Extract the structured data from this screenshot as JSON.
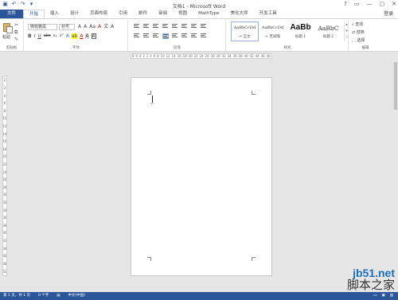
{
  "window": {
    "title": "文档1 - Microsoft Word",
    "controls": [
      "?",
      "▭",
      "—",
      "▢",
      "✕"
    ]
  },
  "quick_access": {
    "icons": [
      "save-icon",
      "undo-icon",
      "redo-icon",
      "customize-icon"
    ]
  },
  "tabs": [
    {
      "label": "文件",
      "kind": "file"
    },
    {
      "label": "开始",
      "kind": "active"
    },
    {
      "label": "插入"
    },
    {
      "label": "设计"
    },
    {
      "label": "页面布局"
    },
    {
      "label": "引用"
    },
    {
      "label": "邮件"
    },
    {
      "label": "审阅"
    },
    {
      "label": "视图"
    },
    {
      "label": "MathType"
    },
    {
      "label": "美化大师"
    },
    {
      "label": "开发工具"
    }
  ],
  "user_label": "登录",
  "ribbon": {
    "clipboard": {
      "group_label": "剪贴板",
      "paste_label": "粘贴"
    },
    "font": {
      "group_label": "字体",
      "font_name": "微软雅黑",
      "font_size": "初号",
      "row1": [
        "A",
        "A",
        "Aa",
        "A",
        "文",
        "A"
      ],
      "row2": [
        "B",
        "I",
        "U",
        "abc",
        "x₂",
        "x²",
        "A",
        "ab",
        "A",
        "A",
        "A"
      ]
    },
    "paragraph": {
      "group_label": "段落"
    },
    "styles": {
      "group_label": "样式",
      "items": [
        {
          "preview": "AaBbCcDd",
          "name": "↵ 正文",
          "size": "small",
          "selected": true
        },
        {
          "preview": "AaBbCcDd",
          "name": "↵ 无间隔",
          "size": "small"
        },
        {
          "preview": "AaBb",
          "name": "标题 1",
          "size": "big"
        },
        {
          "preview": "AaBbC",
          "name": "标题 2",
          "size": "mid"
        }
      ]
    },
    "editing": {
      "group_label": "编辑",
      "items": [
        "查找",
        "替换",
        "选择"
      ]
    }
  },
  "hruler": [
    "8",
    "6",
    "4",
    "2",
    "2",
    "4",
    "6",
    "8",
    "10",
    "12",
    "14",
    "16",
    "18",
    "20",
    "22",
    "24",
    "26",
    "28",
    "30",
    "32",
    "34",
    "36",
    "38",
    "40",
    "42",
    "44",
    "46",
    "48"
  ],
  "vruler": [
    "2",
    "2",
    "4",
    "6",
    "8",
    "10",
    "12",
    "14",
    "16",
    "18",
    "20",
    "22",
    "24",
    "26",
    "28",
    "30",
    "32",
    "34",
    "36",
    "38",
    "40",
    "42",
    "44",
    "46",
    "48",
    "50"
  ],
  "status": {
    "page": "第 1 页，共 1 页",
    "words": "0 个字",
    "language": "中文(中国)"
  },
  "watermark": {
    "site": "jb51.net",
    "name": "脚本之家"
  }
}
